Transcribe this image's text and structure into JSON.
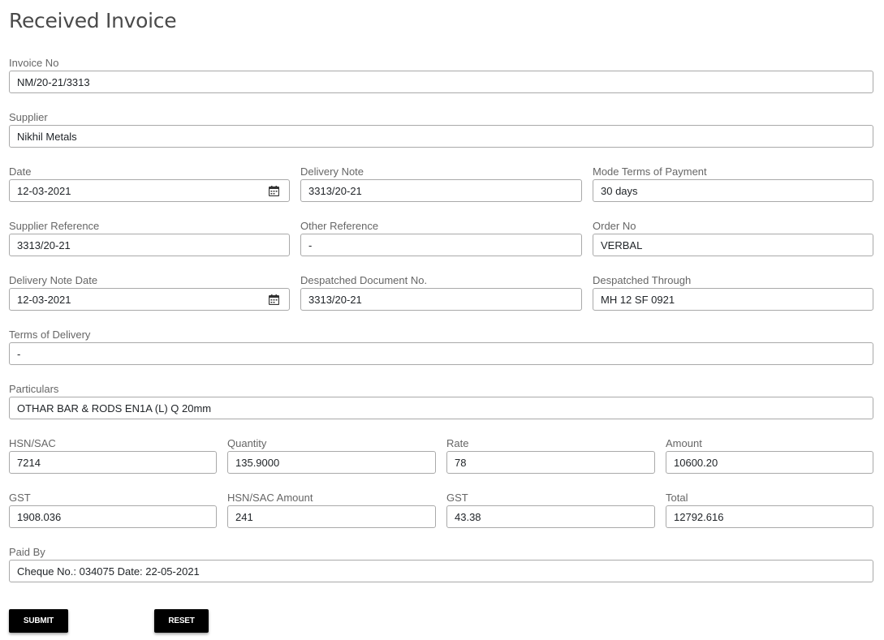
{
  "page": {
    "title": "Received Invoice"
  },
  "fields": {
    "invoice_no": {
      "label": "Invoice No",
      "value": "NM/20-21/3313"
    },
    "supplier": {
      "label": "Supplier",
      "value": "Nikhil Metals"
    },
    "date": {
      "label": "Date",
      "value": "12-03-2021",
      "icon": "calendar-icon"
    },
    "delivery_note": {
      "label": "Delivery Note",
      "value": "3313/20-21"
    },
    "mode_terms_of_payment": {
      "label": "Mode Terms of Payment",
      "value": "30 days"
    },
    "supplier_reference": {
      "label": "Supplier Reference",
      "value": "3313/20-21"
    },
    "other_reference": {
      "label": "Other Reference",
      "value": "-"
    },
    "order_no": {
      "label": "Order No",
      "value": "VERBAL"
    },
    "delivery_note_date": {
      "label": "Delivery Note Date",
      "value": "12-03-2021",
      "icon": "calendar-icon"
    },
    "despatched_document_no": {
      "label": "Despatched Document No.",
      "value": "3313/20-21"
    },
    "despatched_through": {
      "label": "Despatched Through",
      "value": "MH 12 SF 0921"
    },
    "terms_of_delivery": {
      "label": "Terms of Delivery",
      "value": "-"
    },
    "particulars": {
      "label": "Particulars",
      "value": "OTHAR BAR & RODS EN1A (L) Q 20mm"
    },
    "hsn_sac": {
      "label": "HSN/SAC",
      "value": "7214"
    },
    "quantity": {
      "label": "Quantity",
      "value": "135.9000"
    },
    "rate": {
      "label": "Rate",
      "value": "78"
    },
    "amount": {
      "label": "Amount",
      "value": "10600.20"
    },
    "gst": {
      "label": "GST",
      "value": "1908.036"
    },
    "hsn_sac_amount": {
      "label": "HSN/SAC Amount",
      "value": "241"
    },
    "gst_2": {
      "label": "GST",
      "value": "43.38"
    },
    "total": {
      "label": "Total",
      "value": "12792.616"
    },
    "paid_by": {
      "label": "Paid By",
      "value": "Cheque No.: 034075 Date: 22-05-2021"
    }
  },
  "actions": {
    "submit_label": "SUBMIT",
    "reset_label": "RESET"
  },
  "colors": {
    "title": "#4a4a4a",
    "label": "#666666",
    "input_border": "#a9a9a9",
    "button_bg": "#000000",
    "button_text": "#ffffff"
  }
}
